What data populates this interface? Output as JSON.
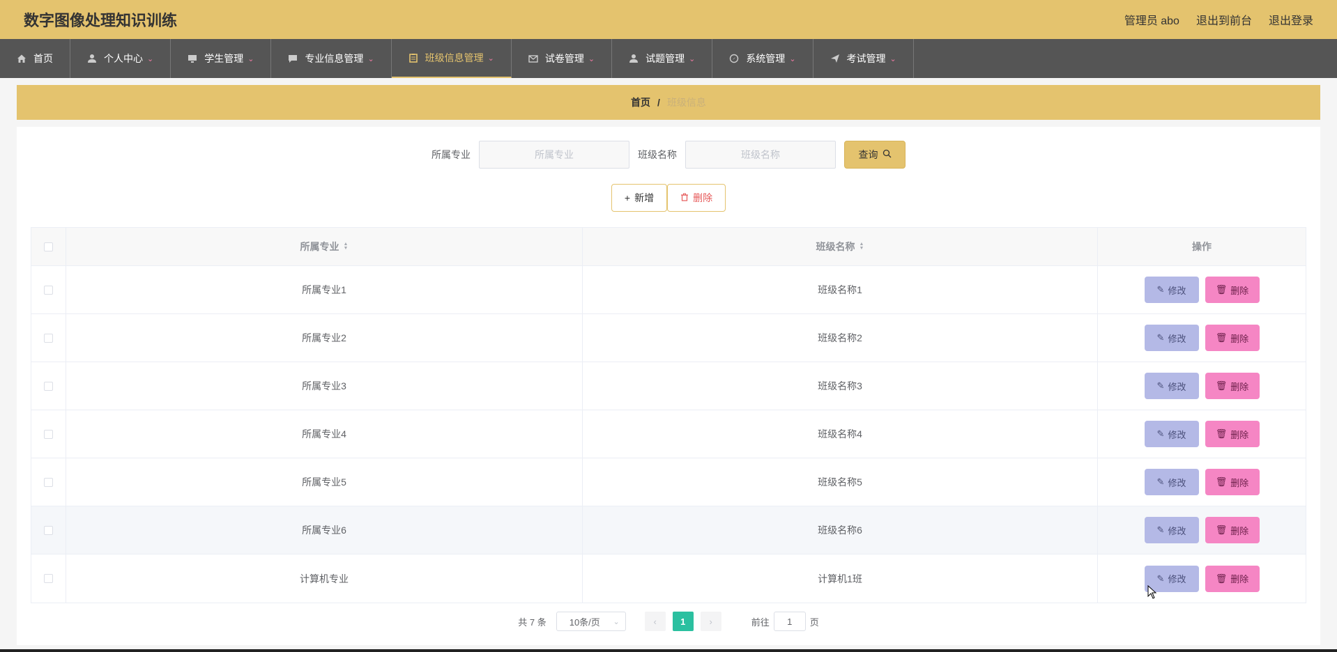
{
  "header": {
    "title": "数字图像处理知识训练",
    "admin_label": "管理员 abo",
    "to_front_label": "退出到前台",
    "logout_label": "退出登录"
  },
  "nav": {
    "items": [
      {
        "label": "首页",
        "icon": "home-icon"
      },
      {
        "label": "个人中心",
        "icon": "user-icon"
      },
      {
        "label": "学生管理",
        "icon": "monitor-icon"
      },
      {
        "label": "专业信息管理",
        "icon": "chat-icon"
      },
      {
        "label": "班级信息管理",
        "icon": "clipboard-icon"
      },
      {
        "label": "试卷管理",
        "icon": "mail-icon"
      },
      {
        "label": "试题管理",
        "icon": "user-icon"
      },
      {
        "label": "系统管理",
        "icon": "compass-icon"
      },
      {
        "label": "考试管理",
        "icon": "send-icon"
      }
    ],
    "active_index": 4
  },
  "breadcrumb": {
    "home": "首页",
    "separator": "/",
    "current": "班级信息"
  },
  "search": {
    "major_label": "所属专业",
    "major_placeholder": "所属专业",
    "class_label": "班级名称",
    "class_placeholder": "班级名称",
    "query_label": "查询"
  },
  "actions": {
    "add_label": "新增",
    "delete_label": "删除"
  },
  "table": {
    "columns": [
      "所属专业",
      "班级名称",
      "操作"
    ],
    "rows": [
      {
        "major": "所属专业1",
        "class": "班级名称1"
      },
      {
        "major": "所属专业2",
        "class": "班级名称2"
      },
      {
        "major": "所属专业3",
        "class": "班级名称3"
      },
      {
        "major": "所属专业4",
        "class": "班级名称4"
      },
      {
        "major": "所属专业5",
        "class": "班级名称5"
      },
      {
        "major": "所属专业6",
        "class": "班级名称6"
      },
      {
        "major": "计算机专业",
        "class": "计算机1班"
      }
    ],
    "edit_label": "修改",
    "delete_label": "删除"
  },
  "pagination": {
    "total_text": "共 7 条",
    "page_size": "10条/页",
    "current_page": "1",
    "goto_prefix": "前往",
    "goto_value": "1",
    "goto_suffix": "页"
  },
  "colors": {
    "accent": "#e4c36e",
    "nav_bg": "#555555",
    "edit_button": "#b4b9e6",
    "delete_button": "#f586c4",
    "active_page": "#2bc0a0"
  }
}
